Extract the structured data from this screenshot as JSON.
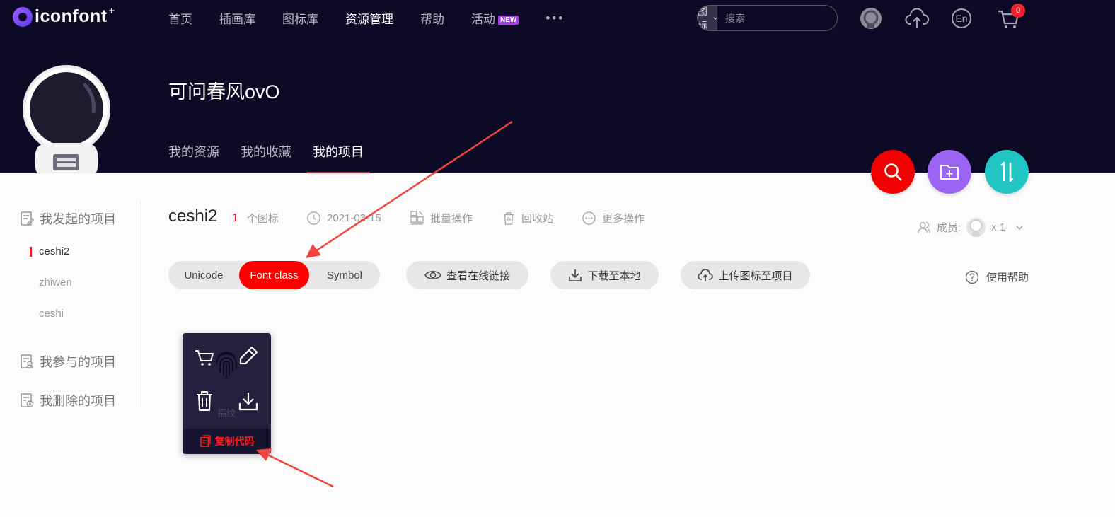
{
  "brand": {
    "name": "iconfont",
    "plus": "+"
  },
  "nav": {
    "items": [
      "首页",
      "插画库",
      "图标库",
      "资源管理",
      "帮助",
      "活动"
    ],
    "active": "资源管理",
    "new_badge": "NEW",
    "more": "•••"
  },
  "search": {
    "type": "图标",
    "placeholder": "搜索"
  },
  "cart": {
    "count": "0"
  },
  "header_icons": [
    "user-avatar-icon",
    "cloud-upload-icon",
    "language-en-icon",
    "cart-icon"
  ],
  "language": "En",
  "profile": {
    "name": "可问春风ovO"
  },
  "subnav": {
    "items": [
      "我的资源",
      "我的收藏",
      "我的项目"
    ],
    "active": "我的项目"
  },
  "sidebar": {
    "groups": [
      "我发起的项目",
      "我参与的项目",
      "我删除的项目"
    ],
    "projects": [
      "ceshi2",
      "zhiwen",
      "ceshi"
    ],
    "active_project": "ceshi2"
  },
  "project": {
    "title": "ceshi2",
    "icon_count": "1",
    "icon_count_label": "个图标",
    "date": "2021-03-15",
    "batch": "批量操作",
    "recycle": "回收站",
    "more": "更多操作",
    "members_label": "成员:",
    "members_count": "x 1"
  },
  "toolbar": {
    "modes": [
      "Unicode",
      "Font class",
      "Symbol"
    ],
    "active_mode": "Font class",
    "view_link": "查看在线链接",
    "download": "下载至本地",
    "upload": "上传图标至项目",
    "help": "使用帮助"
  },
  "icon_card": {
    "name": "指纹",
    "copy_code": "复制代码",
    "actions": [
      "cart-icon",
      "edit-icon",
      "delete-icon",
      "download-icon"
    ]
  },
  "colors": {
    "header_bg": "#0c0a24",
    "accent_red": "#ff0000",
    "search_btn": "#f00000",
    "folder_btn": "#9b64f2",
    "sort_btn": "#21c6c4",
    "annotation_arrow": "#f0443c"
  }
}
